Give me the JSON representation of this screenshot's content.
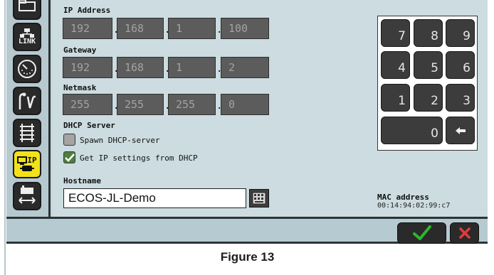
{
  "sidebar": {
    "items": [
      {
        "name": "folder"
      },
      {
        "name": "link",
        "label": "LINK"
      },
      {
        "name": "gauge"
      },
      {
        "name": "signal"
      },
      {
        "name": "track"
      },
      {
        "name": "ip",
        "label": "IP",
        "active": true
      },
      {
        "name": "loco-arrows"
      }
    ]
  },
  "network": {
    "ip_label": "IP Address",
    "ip": [
      "192",
      "168",
      "1",
      "100"
    ],
    "gateway_label": "Gateway",
    "gateway": [
      "192",
      "168",
      "1",
      "2"
    ],
    "netmask_label": "Netmask",
    "netmask": [
      "255",
      "255",
      "255",
      "0"
    ]
  },
  "dhcp": {
    "title": "DHCP Server",
    "spawn_label": "Spawn DHCP-server",
    "spawn_checked": false,
    "get_label": "Get IP settings from DHCP",
    "get_checked": true
  },
  "host": {
    "label": "Hostname",
    "value": "ECOS-JL-Demo"
  },
  "keypad": {
    "keys": [
      "7",
      "8",
      "9",
      "4",
      "5",
      "6",
      "1",
      "2",
      "3",
      "0"
    ]
  },
  "mac": {
    "label": "MAC address",
    "value": "00:14:94:02:99:c7"
  },
  "caption": "Figure 13",
  "colors": {
    "accent_active": "#f3e21a",
    "ok_check": "#2fb52f",
    "cancel_x": "#e33b3b"
  }
}
